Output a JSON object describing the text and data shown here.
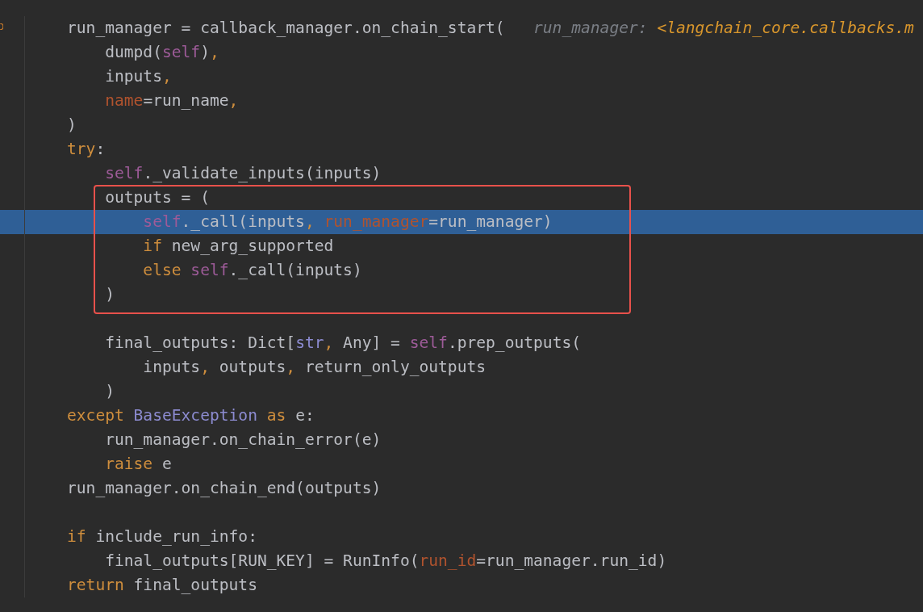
{
  "editor": {
    "lines": [
      {
        "highlighted": false,
        "tokens": [
          {
            "kind": "plain",
            "text": "run_manager = callback_manager.on_chain_start(   "
          },
          {
            "kind": "hint",
            "text": "run_manager: "
          },
          {
            "kind": "hint-type",
            "text": "<langchain_core.callbacks.m"
          }
        ]
      },
      {
        "highlighted": false,
        "tokens": [
          {
            "kind": "plain",
            "text": "    dumpd("
          },
          {
            "kind": "self",
            "text": "self"
          },
          {
            "kind": "plain",
            "text": ")"
          },
          {
            "kind": "punct",
            "text": ","
          }
        ]
      },
      {
        "highlighted": false,
        "tokens": [
          {
            "kind": "plain",
            "text": "    inputs"
          },
          {
            "kind": "punct",
            "text": ","
          }
        ]
      },
      {
        "highlighted": false,
        "tokens": [
          {
            "kind": "param",
            "text": "    name"
          },
          {
            "kind": "plain",
            "text": "=run_name"
          },
          {
            "kind": "punct",
            "text": ","
          }
        ]
      },
      {
        "highlighted": false,
        "tokens": [
          {
            "kind": "plain",
            "text": ")"
          }
        ]
      },
      {
        "highlighted": false,
        "tokens": [
          {
            "kind": "keyword",
            "text": "try"
          },
          {
            "kind": "plain",
            "text": ":"
          }
        ]
      },
      {
        "highlighted": false,
        "tokens": [
          {
            "kind": "self",
            "text": "    self"
          },
          {
            "kind": "plain",
            "text": "._validate_inputs(inputs)"
          }
        ]
      },
      {
        "highlighted": false,
        "tokens": [
          {
            "kind": "plain",
            "text": "    outputs = ("
          }
        ]
      },
      {
        "highlighted": true,
        "tokens": [
          {
            "kind": "self",
            "text": "        self"
          },
          {
            "kind": "plain",
            "text": "._call(inputs"
          },
          {
            "kind": "punct",
            "text": ", "
          },
          {
            "kind": "param",
            "text": "run_manager"
          },
          {
            "kind": "plain",
            "text": "=run_manager)"
          }
        ]
      },
      {
        "highlighted": false,
        "tokens": [
          {
            "kind": "keyword",
            "text": "        if "
          },
          {
            "kind": "plain",
            "text": "new_arg_supported"
          }
        ]
      },
      {
        "highlighted": false,
        "tokens": [
          {
            "kind": "keyword",
            "text": "        else "
          },
          {
            "kind": "self",
            "text": "self"
          },
          {
            "kind": "plain",
            "text": "._call(inputs)"
          }
        ]
      },
      {
        "highlighted": false,
        "tokens": [
          {
            "kind": "plain",
            "text": "    )"
          }
        ]
      },
      {
        "highlighted": false,
        "gap_before": true,
        "tokens": [
          {
            "kind": "plain",
            "text": "    final_outputs: Dict["
          },
          {
            "kind": "builtin",
            "text": "str"
          },
          {
            "kind": "punct",
            "text": ", "
          },
          {
            "kind": "plain",
            "text": "Any] = "
          },
          {
            "kind": "self",
            "text": "self"
          },
          {
            "kind": "plain",
            "text": ".prep_outputs("
          }
        ]
      },
      {
        "highlighted": false,
        "tokens": [
          {
            "kind": "plain",
            "text": "        inputs"
          },
          {
            "kind": "punct",
            "text": ", "
          },
          {
            "kind": "plain",
            "text": "outputs"
          },
          {
            "kind": "punct",
            "text": ", "
          },
          {
            "kind": "plain",
            "text": "return_only_outputs"
          }
        ]
      },
      {
        "highlighted": false,
        "tokens": [
          {
            "kind": "plain",
            "text": "    )"
          }
        ]
      },
      {
        "highlighted": false,
        "tokens": [
          {
            "kind": "keyword",
            "text": "except "
          },
          {
            "kind": "builtin",
            "text": "BaseException"
          },
          {
            "kind": "keyword",
            "text": " as "
          },
          {
            "kind": "plain",
            "text": "e:"
          }
        ]
      },
      {
        "highlighted": false,
        "tokens": [
          {
            "kind": "plain",
            "text": "    run_manager.on_chain_error(e)"
          }
        ]
      },
      {
        "highlighted": false,
        "tokens": [
          {
            "kind": "keyword",
            "text": "    raise "
          },
          {
            "kind": "plain",
            "text": "e"
          }
        ]
      },
      {
        "highlighted": false,
        "tokens": [
          {
            "kind": "plain",
            "text": "run_manager.on_chain_end(outputs)"
          }
        ]
      },
      {
        "highlighted": false,
        "gap_before": true,
        "tokens": [
          {
            "kind": "keyword",
            "text": "if "
          },
          {
            "kind": "plain",
            "text": "include_run_info:"
          }
        ]
      },
      {
        "highlighted": false,
        "tokens": [
          {
            "kind": "plain",
            "text": "    final_outputs[RUN_KEY] = RunInfo("
          },
          {
            "kind": "param",
            "text": "run_id"
          },
          {
            "kind": "plain",
            "text": "=run_manager.run_id)"
          }
        ]
      },
      {
        "highlighted": false,
        "tokens": [
          {
            "kind": "keyword",
            "text": "return "
          },
          {
            "kind": "plain",
            "text": "final_outputs"
          }
        ]
      }
    ]
  }
}
